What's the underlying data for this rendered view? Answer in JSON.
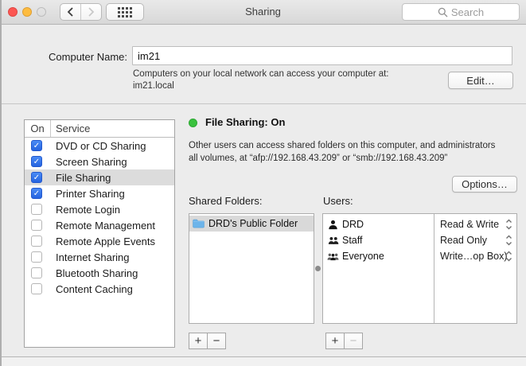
{
  "titlebar": {
    "title": "Sharing",
    "search_placeholder": "Search"
  },
  "computer_name": {
    "label": "Computer Name:",
    "value": "im21",
    "help_line1": "Computers on your local network can access your computer at:",
    "help_line2": "im21.local",
    "edit_button": "Edit…"
  },
  "services": {
    "col_on": "On",
    "col_service": "Service",
    "items": [
      {
        "label": "DVD or CD Sharing",
        "checked": true,
        "selected": false
      },
      {
        "label": "Screen Sharing",
        "checked": true,
        "selected": false
      },
      {
        "label": "File Sharing",
        "checked": true,
        "selected": true
      },
      {
        "label": "Printer Sharing",
        "checked": true,
        "selected": false
      },
      {
        "label": "Remote Login",
        "checked": false,
        "selected": false
      },
      {
        "label": "Remote Management",
        "checked": false,
        "selected": false
      },
      {
        "label": "Remote Apple Events",
        "checked": false,
        "selected": false
      },
      {
        "label": "Internet Sharing",
        "checked": false,
        "selected": false
      },
      {
        "label": "Bluetooth Sharing",
        "checked": false,
        "selected": false
      },
      {
        "label": "Content Caching",
        "checked": false,
        "selected": false
      }
    ]
  },
  "status": {
    "title": "File Sharing: On",
    "description_line1": "Other users can access shared folders on this computer, and administrators",
    "description_line2": "all volumes, at “afp://192.168.43.209” or “smb://192.168.43.209”",
    "options_button": "Options…"
  },
  "shared_folders": {
    "label": "Shared Folders:",
    "items": [
      {
        "name": "DRD's Public Folder",
        "icon": "folder-icon",
        "selected": true
      }
    ],
    "add_button": "+",
    "remove_button": "−"
  },
  "users": {
    "label": "Users:",
    "items": [
      {
        "name": "DRD",
        "icon": "user-icon",
        "permission": "Read & Write"
      },
      {
        "name": "Staff",
        "icon": "user-pair-icon",
        "permission": "Read Only"
      },
      {
        "name": "Everyone",
        "icon": "user-group-icon",
        "permission": "Write…op Box)"
      }
    ],
    "add_button": "+",
    "remove_button": "−"
  },
  "colors": {
    "checkbox_blue": "#2f6ee3",
    "status_green": "#3ac23e",
    "folder_blue": "#6cb4ea",
    "selection_gray": "#dcdcdc"
  }
}
